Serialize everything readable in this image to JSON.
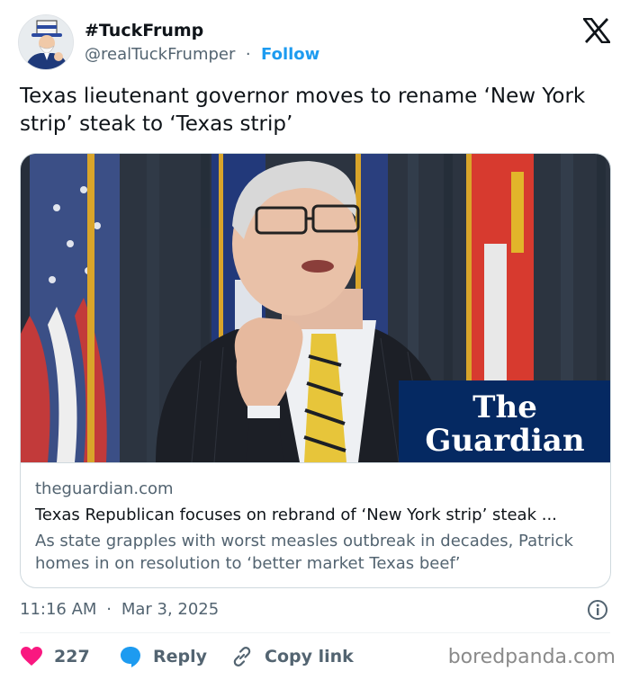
{
  "tweet": {
    "display_name": "#TuckFrump",
    "handle": "@realTuckFrumper",
    "separator": "·",
    "follow_label": "Follow",
    "text": "Texas lieutenant governor moves to rename ‘New York strip’ steak to ‘Texas strip’"
  },
  "card": {
    "image_logo_line1": "The",
    "image_logo_line2": "Guardian",
    "domain": "theguardian.com",
    "title": "Texas Republican focuses on rebrand of ‘New York strip’ steak ...",
    "description": "As state grapples with worst measles outbreak in decades, Patrick homes in on resolution to ‘better market Texas beef’"
  },
  "meta": {
    "time": "11:16 AM",
    "separator": "·",
    "date": "Mar 3, 2025"
  },
  "actions": {
    "like_count": "227",
    "reply_label": "Reply",
    "copy_link_label": "Copy link"
  },
  "watermark": "boredpanda.com",
  "colors": {
    "accent": "#1d9bf0",
    "like": "#f91880",
    "muted": "#536471",
    "guardian_blue": "#052962"
  },
  "icons": [
    "uncle-sam-avatar",
    "x-logo-icon",
    "info-icon",
    "heart-icon",
    "reply-bubble-icon",
    "link-icon"
  ]
}
